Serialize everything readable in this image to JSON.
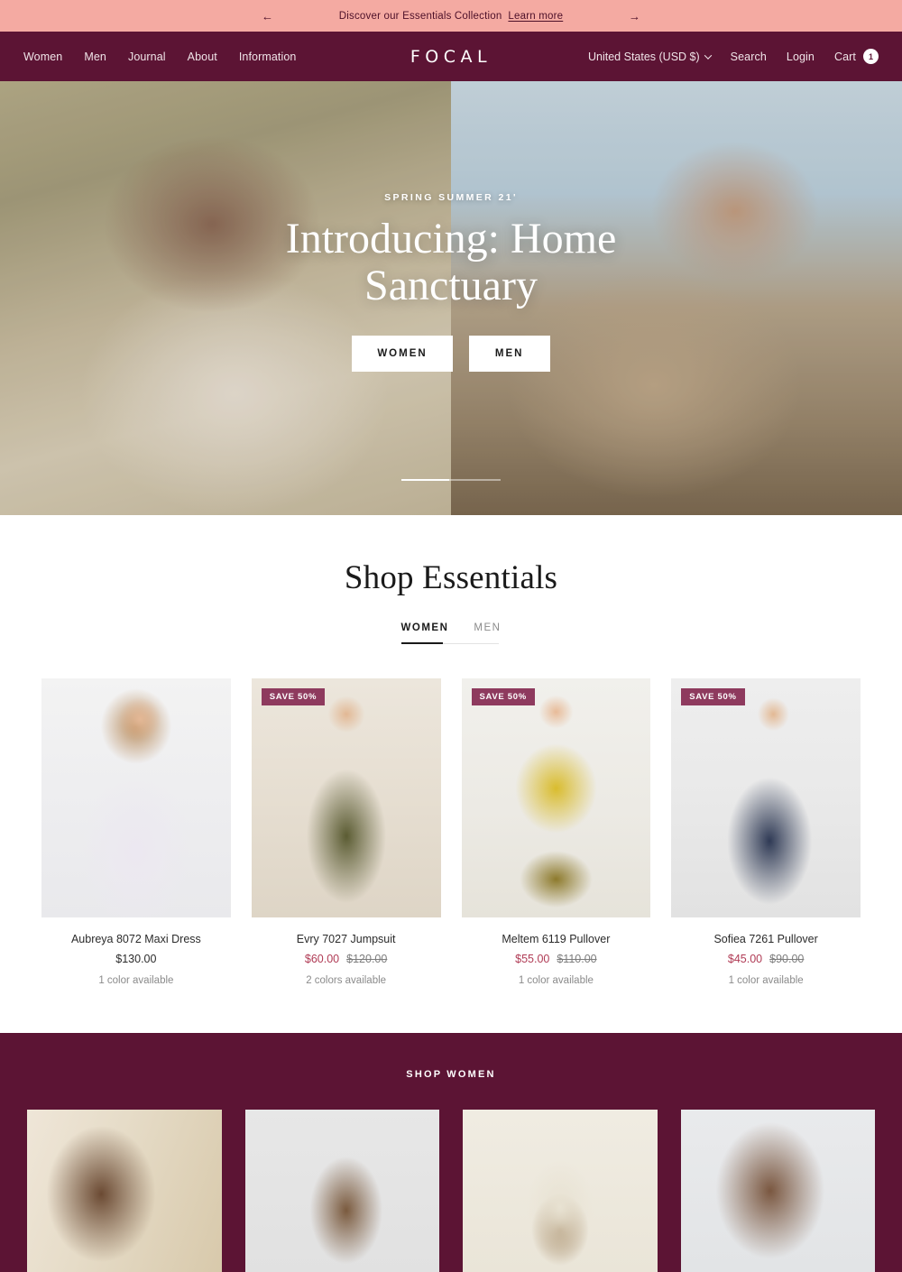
{
  "announcement": {
    "text": "Discover our Essentials Collection",
    "link_label": "Learn more",
    "prev_icon": "arrow-left-icon",
    "next_icon": "arrow-right-icon",
    "prev_glyph": "←",
    "next_glyph": "→",
    "background": "#f4aaa2",
    "text_color": "#4d1029"
  },
  "header": {
    "brand": "FOCAL",
    "background": "#5c1434",
    "nav_left": [
      {
        "label": "Women"
      },
      {
        "label": "Men"
      },
      {
        "label": "Journal"
      },
      {
        "label": "About"
      },
      {
        "label": "Information"
      }
    ],
    "locale": "United States (USD $)",
    "search_label": "Search",
    "login_label": "Login",
    "cart_label": "Cart",
    "cart_count": "1"
  },
  "hero": {
    "eyebrow": "SPRING SUMMER 21'",
    "title": "Introducing: Home Sanctuary",
    "buttons": [
      {
        "label": "WOMEN"
      },
      {
        "label": "MEN"
      }
    ],
    "slider_progress": "48"
  },
  "essentials": {
    "title": "Shop Essentials",
    "tabs": [
      {
        "label": "WOMEN",
        "active": true
      },
      {
        "label": "MEN",
        "active": false
      }
    ],
    "products": [
      {
        "title": "Aubreya 8072 Maxi Dress",
        "price": "$130.00",
        "compare_at": "",
        "badge": "",
        "colors": "1 color available",
        "on_sale": false
      },
      {
        "title": "Evry 7027 Jumpsuit",
        "price": "$60.00",
        "compare_at": "$120.00",
        "badge": "SAVE 50%",
        "colors": "2 colors available",
        "on_sale": true
      },
      {
        "title": "Meltem 6119 Pullover",
        "price": "$55.00",
        "compare_at": "$110.00",
        "badge": "SAVE 50%",
        "colors": "1 color available",
        "on_sale": true
      },
      {
        "title": "Sofiea 7261 Pullover",
        "price": "$45.00",
        "compare_at": "$90.00",
        "badge": "SAVE 50%",
        "colors": "1 color available",
        "on_sale": true
      }
    ]
  },
  "shop_women": {
    "title": "SHOP WOMEN",
    "background": "#5c1434",
    "cards": [
      {
        "name": "women-card-1"
      },
      {
        "name": "women-card-2"
      },
      {
        "name": "women-card-3"
      },
      {
        "name": "women-card-4"
      }
    ]
  },
  "colors": {
    "brand_maroon": "#5c1434",
    "announce_pink": "#f4aaa2",
    "sale_red": "#b03b55",
    "badge_bg": "#8e3a5e"
  }
}
